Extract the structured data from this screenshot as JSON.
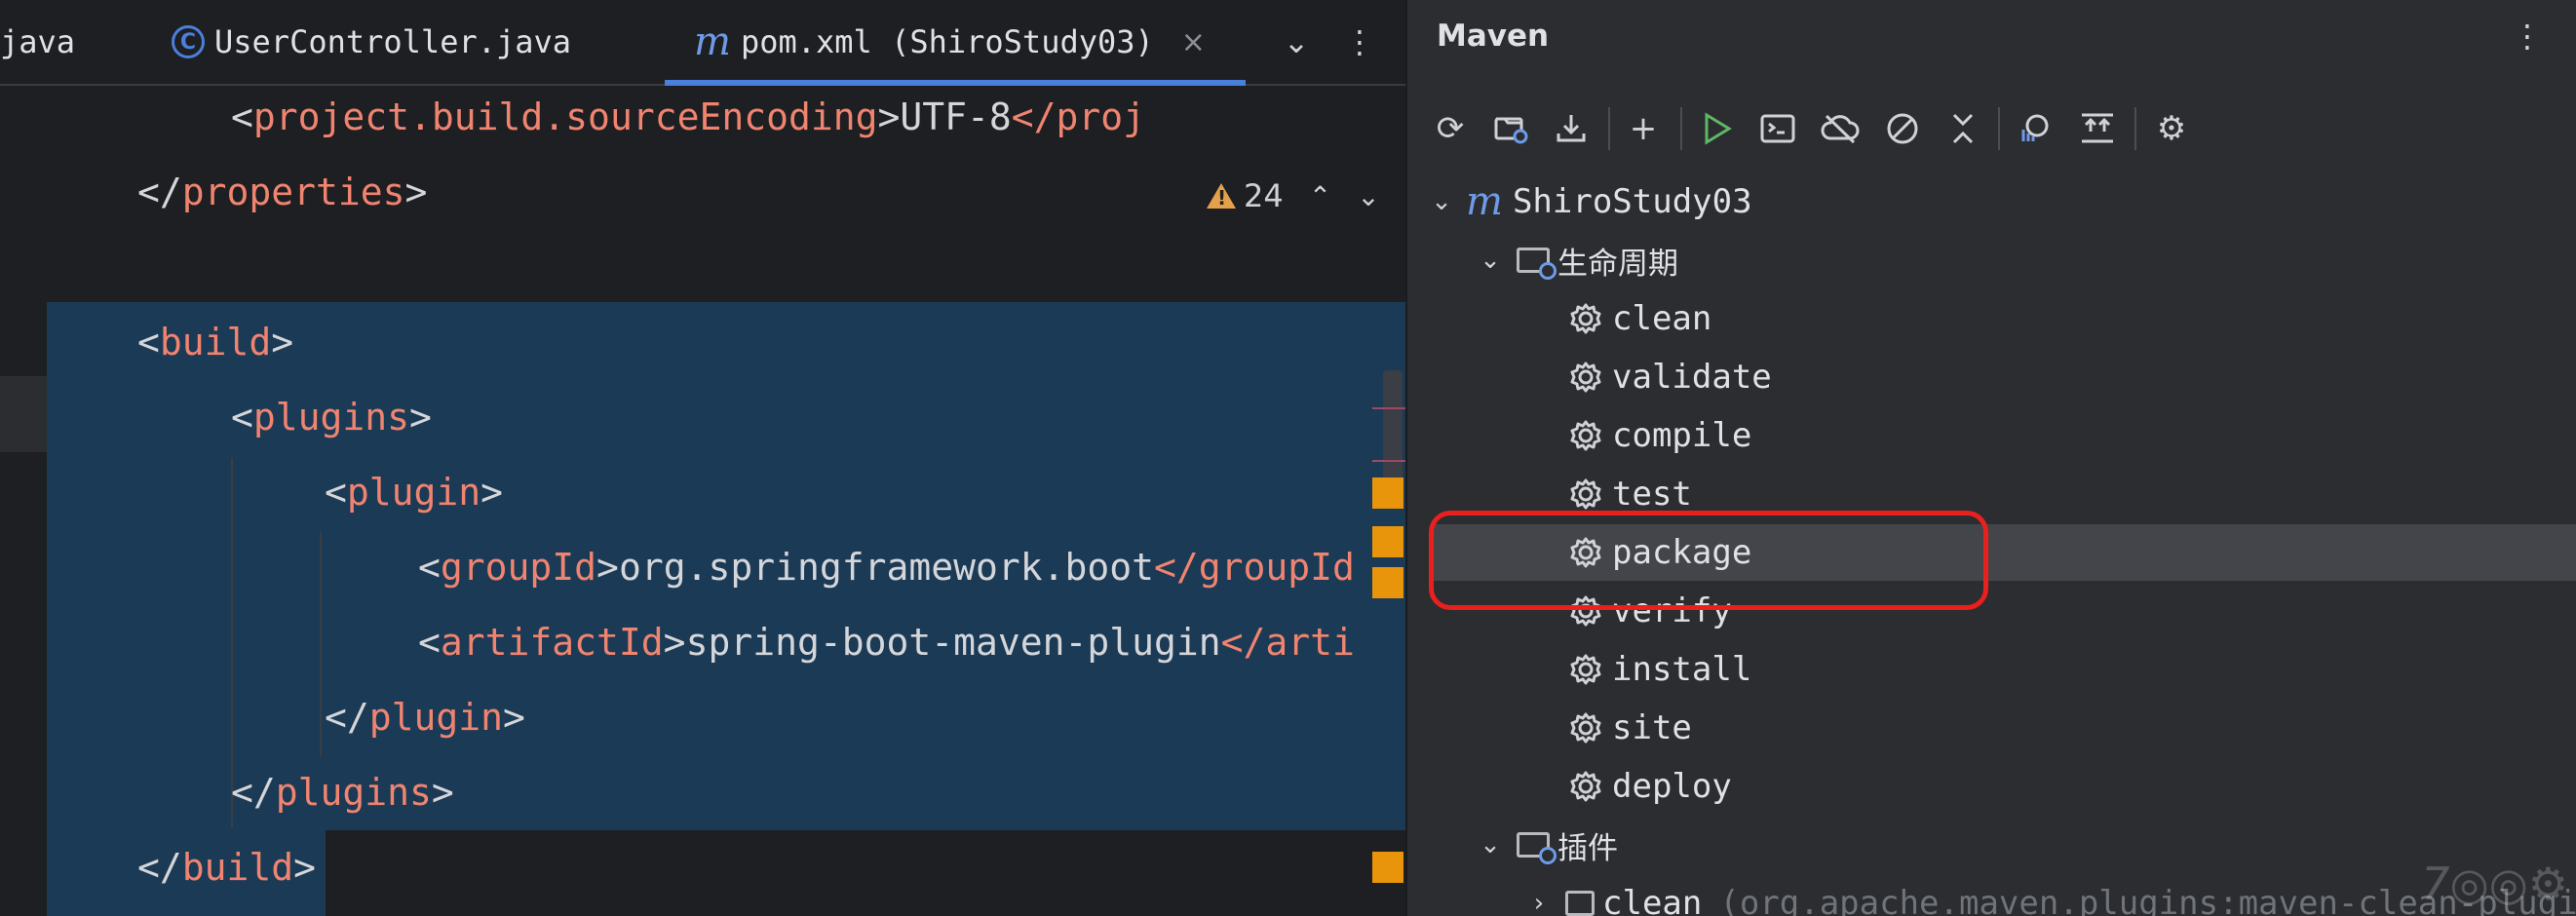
{
  "editor": {
    "tabs": [
      {
        "label": "java",
        "icon": "none"
      },
      {
        "label": "UserController.java",
        "icon": "class-c-icon"
      },
      {
        "label": "pom.xml (ShiroStudy03)",
        "icon": "maven-m-icon",
        "active": true
      }
    ],
    "tab_close": "×",
    "warning_count": "24",
    "lines": [
      {
        "indent": 2,
        "open": "project.build.sourceEncoding",
        "text": "UTF-8",
        "close_partial": "</proj"
      },
      {
        "indent": 1,
        "close": "properties"
      },
      {
        "indent": 0,
        "blank": true
      },
      {
        "indent": 1,
        "open": "build"
      },
      {
        "indent": 2,
        "open": "plugins"
      },
      {
        "indent": 3,
        "open": "plugin"
      },
      {
        "indent": 4,
        "open": "groupId",
        "text": "org.springframework.boot",
        "close_partial": "</groupId"
      },
      {
        "indent": 4,
        "open": "artifactId",
        "text": "spring-boot-maven-plugin",
        "close_partial": "</arti"
      },
      {
        "indent": 3,
        "close": "plugin"
      },
      {
        "indent": 2,
        "close": "plugins"
      },
      {
        "indent": 1,
        "close": "build"
      }
    ]
  },
  "maven": {
    "title": "Maven",
    "toolbar": [
      "reload-icon",
      "reimport-icon",
      "download-icon",
      "add-icon",
      "run-icon",
      "execute-goal-icon",
      "offline-icon",
      "skip-tests-icon",
      "collapse-icon",
      "analyze-icon",
      "expand-icon",
      "settings-icon"
    ],
    "project": "ShiroStudy03",
    "lifecycle_label": "生命周期",
    "lifecycle": [
      "clean",
      "validate",
      "compile",
      "test",
      "package",
      "verify",
      "install",
      "site",
      "deploy"
    ],
    "selected": "package",
    "plugins_label": "插件",
    "plugin_item": {
      "name": "clean",
      "detail": "(org.apache.maven.plugins:maven-clean-plugi"
    }
  },
  "colors": {
    "accent": "#4a7fdc",
    "tag": "#f08470",
    "selection": "#1b3a55",
    "highlight": "#e8201e",
    "run": "#5fb865"
  }
}
